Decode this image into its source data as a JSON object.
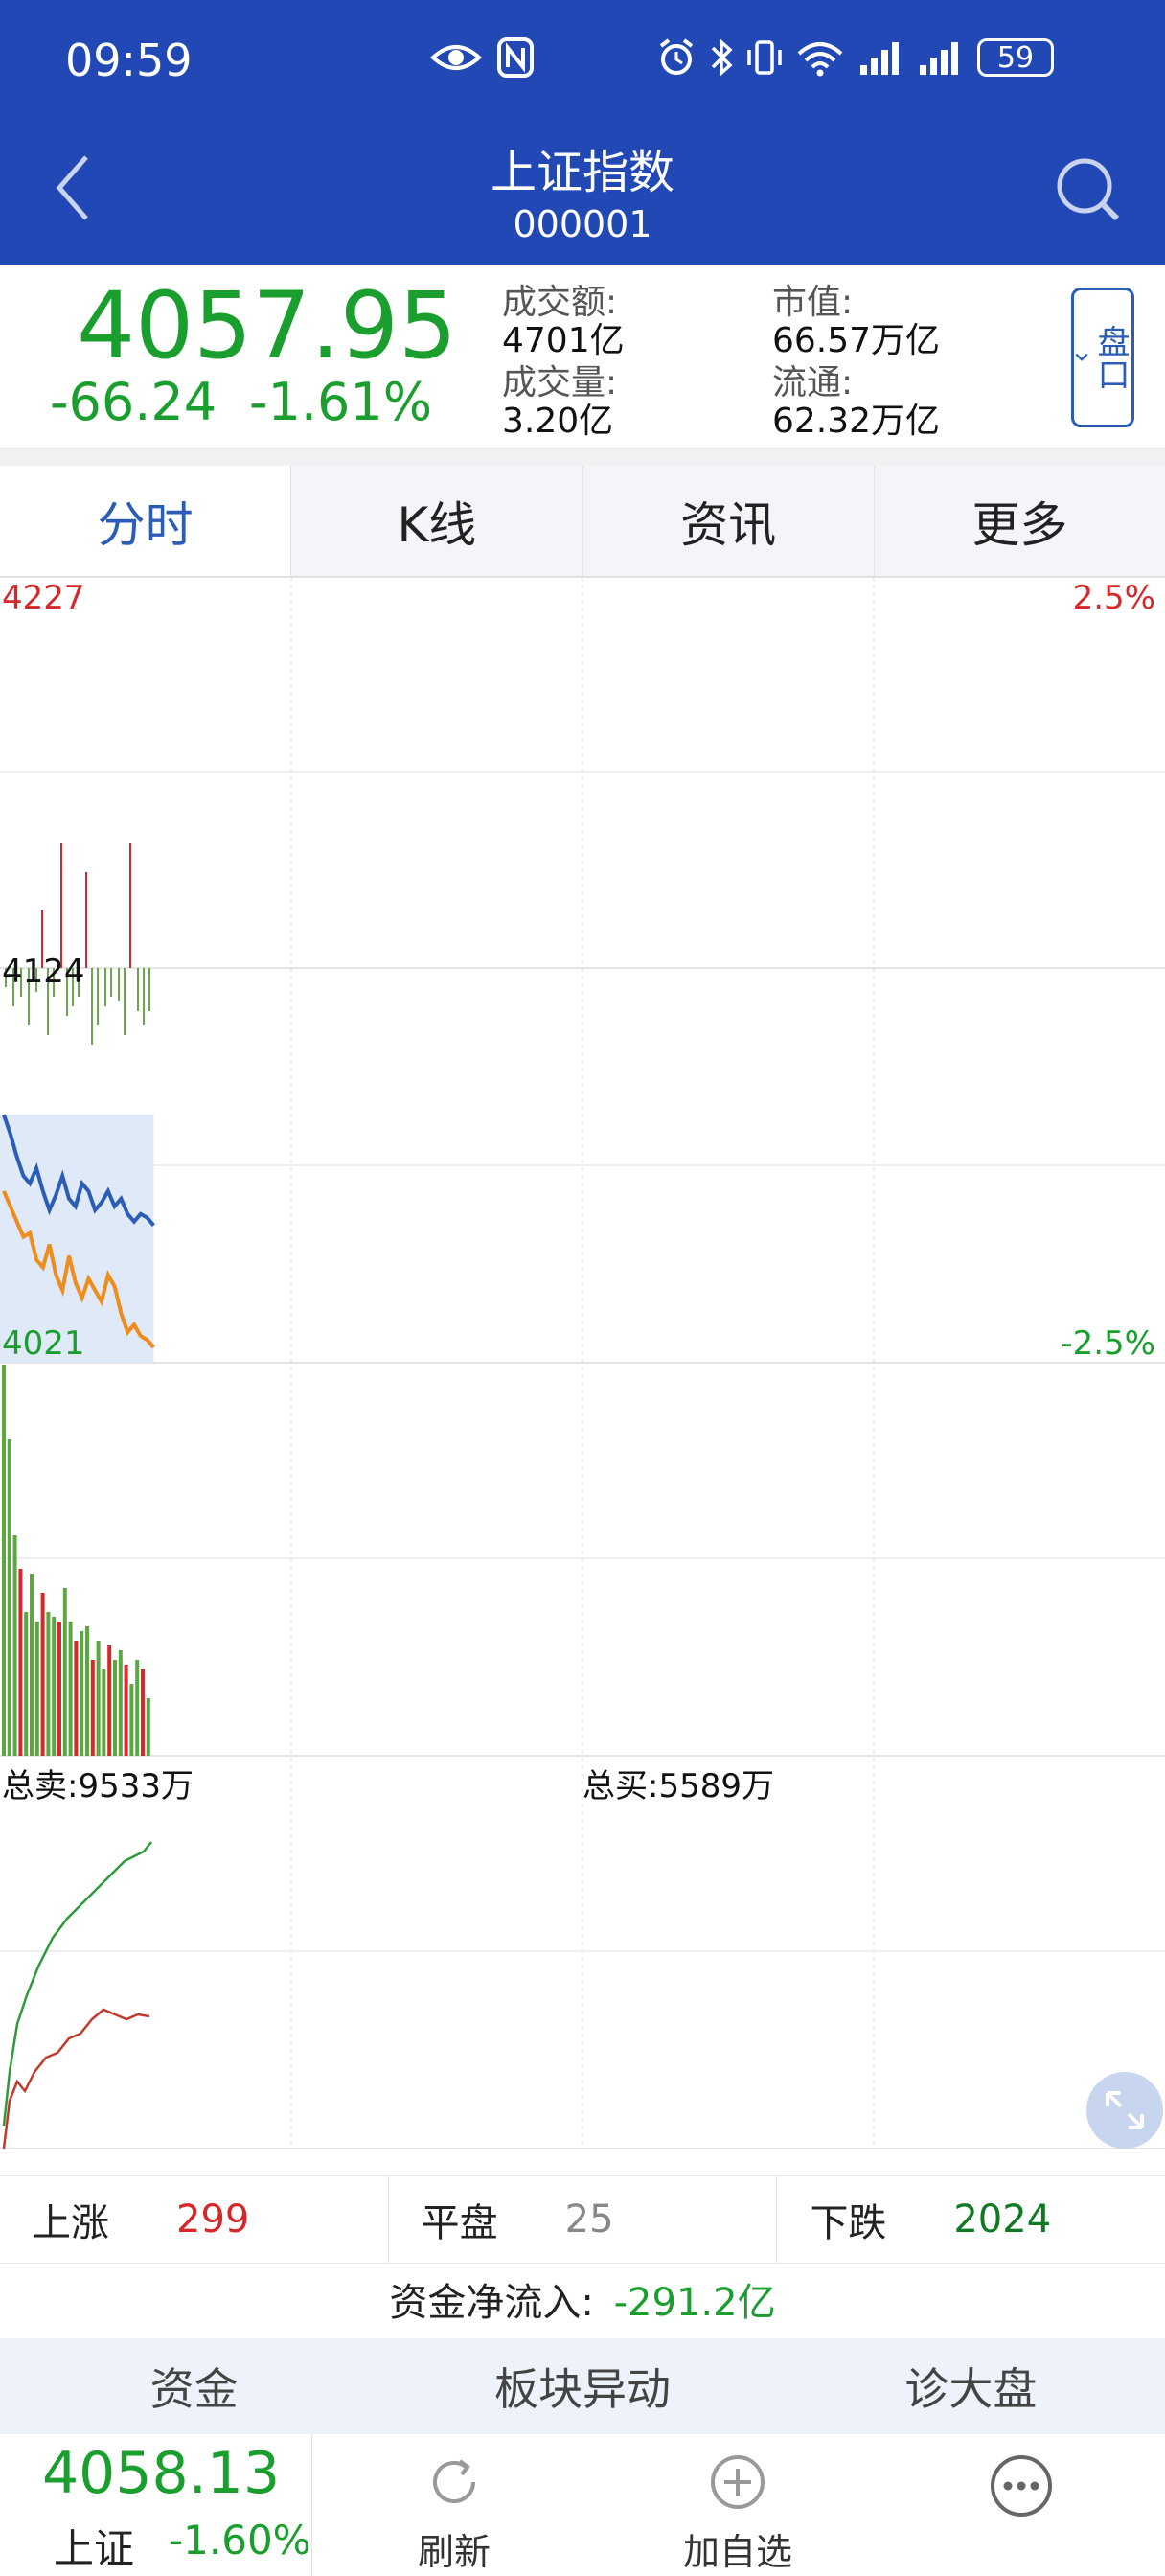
{
  "status_bar": {
    "time": "09:59",
    "battery": "59",
    "icons": [
      "eye-icon",
      "nfc-icon",
      "alarm-icon",
      "bluetooth-icon",
      "vibrate-icon",
      "wifi-icon",
      "signal-icon",
      "signal-icon",
      "battery-icon"
    ]
  },
  "nav": {
    "title": "上证指数",
    "code": "000001",
    "back_icon": "back-arrow-icon",
    "search_icon": "search-icon"
  },
  "quote": {
    "price": "4057.95",
    "change": "-66.24",
    "change_pct": "-1.61%",
    "turnover_label": "成交额:",
    "turnover": "4701亿",
    "volume_label": "成交量:",
    "volume": "3.20亿",
    "market_cap_label": "市值:",
    "market_cap": "66.57万亿",
    "float_cap_label": "流通:",
    "float_cap": "62.32万亿",
    "panel_button": "盘口"
  },
  "tabs": [
    {
      "label": "分时",
      "active": true
    },
    {
      "label": "K线",
      "active": false
    },
    {
      "label": "资讯",
      "active": false
    },
    {
      "label": "更多",
      "active": false
    }
  ],
  "chart_data": {
    "type": "line",
    "price_axis": {
      "high": "4227",
      "mid": "4124",
      "low": "4021",
      "high_pct": "2.5%",
      "low_pct": "-2.5%"
    },
    "series": [
      {
        "values": [
          4086,
          4081,
          4075,
          4070,
          4068,
          4072,
          4066,
          4061,
          4065,
          4070,
          4064,
          4062,
          4068,
          4066,
          4061,
          4063,
          4066,
          4062,
          4064,
          4060,
          4058,
          4060,
          4059,
          4057
        ]
      },
      {
        "values": [
          4066,
          4062,
          4058,
          4054,
          4055,
          4048,
          4046,
          4052,
          4044,
          4040,
          4049,
          4042,
          4038,
          4043,
          4040,
          4037,
          4044,
          4041,
          4034,
          4029,
          4031,
          4028,
          4027,
          4025
        ]
      }
    ],
    "sell_buy": {
      "total_sell": "总卖:9533万",
      "total_buy": "总买:5589万"
    }
  },
  "market_breadth": {
    "up_label": "上涨",
    "up": "299",
    "flat_label": "平盘",
    "flat": "25",
    "down_label": "下跌",
    "down": "2024"
  },
  "net_flow": {
    "label": "资金净流入:",
    "value": "-291.2亿"
  },
  "bottom_tabs": [
    "资金",
    "板块异动",
    "诊大盘"
  ],
  "toolbar": {
    "mini_price": "4058.13",
    "mini_name": "上证",
    "mini_pct": "-1.60%",
    "refresh": "刷新",
    "add_watch": "加自选"
  },
  "colors": {
    "header": "#2148b5",
    "up": "#d62828",
    "down": "#1a9f2e",
    "accent": "#2b5db7"
  }
}
